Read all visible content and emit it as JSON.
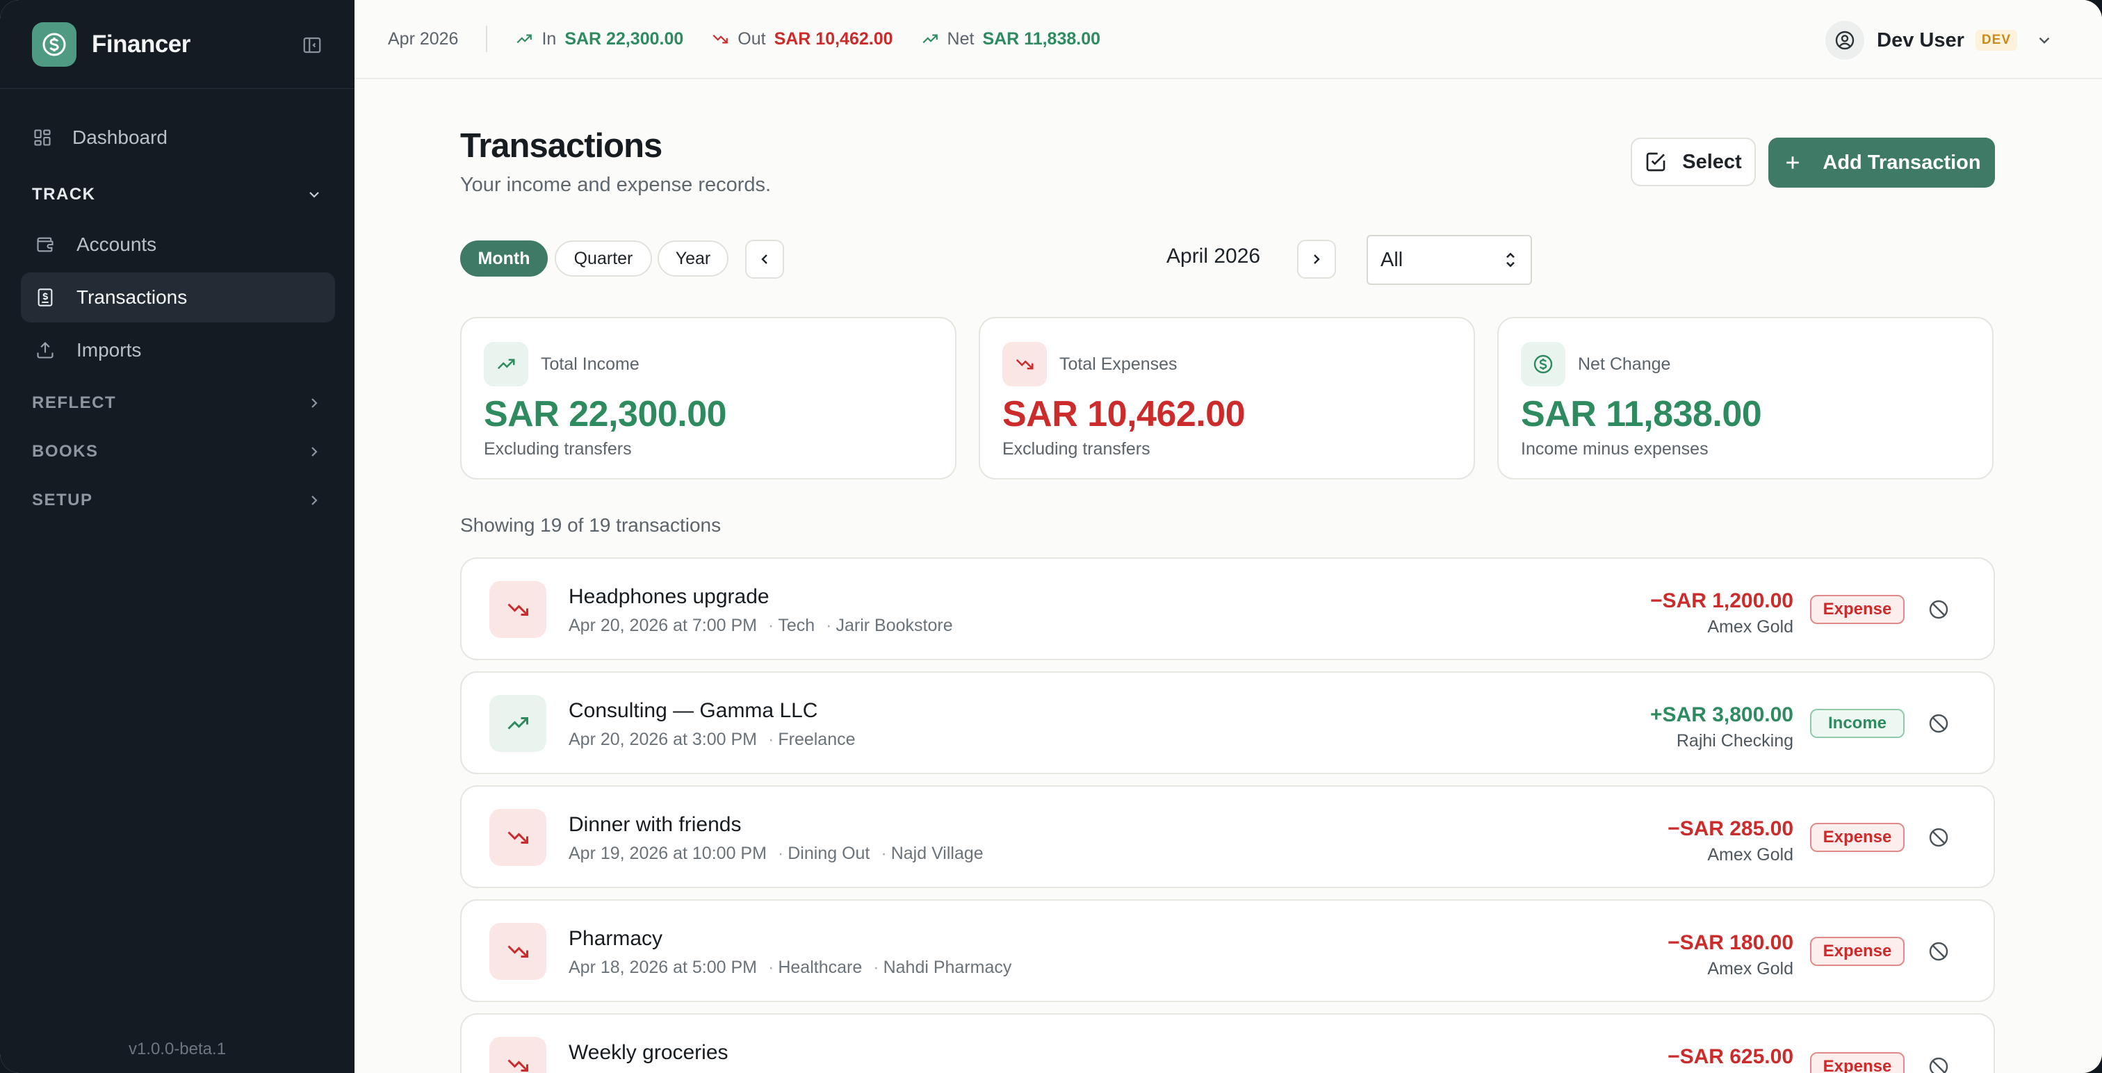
{
  "brand": {
    "name": "Financer"
  },
  "sidebar": {
    "dashboard": "Dashboard",
    "sections": [
      {
        "label": "TRACK"
      },
      {
        "label": "REFLECT"
      },
      {
        "label": "BOOKS"
      },
      {
        "label": "SETUP"
      }
    ],
    "track_items": [
      "Accounts",
      "Transactions",
      "Imports"
    ],
    "version": "v1.0.0-beta.1"
  },
  "topbar": {
    "period": "Apr 2026",
    "in_label": "In",
    "in_value": "SAR 22,300.00",
    "out_label": "Out",
    "out_value": "SAR 10,462.00",
    "net_label": "Net",
    "net_value": "SAR 11,838.00",
    "user_name": "Dev User",
    "env_badge": "DEV"
  },
  "page": {
    "title": "Transactions",
    "subtitle": "Your income and expense records.",
    "select_label": "Select",
    "add_label": "Add Transaction"
  },
  "filters": {
    "ranges": [
      "Month",
      "Quarter",
      "Year"
    ],
    "active_range": "Month",
    "period_label": "April 2026",
    "type_filter": "All"
  },
  "summary": [
    {
      "label": "Total Income",
      "value": "SAR 22,300.00",
      "note": "Excluding transfers"
    },
    {
      "label": "Total Expenses",
      "value": "SAR 10,462.00",
      "note": "Excluding transfers"
    },
    {
      "label": "Net Change",
      "value": "SAR 11,838.00",
      "note": "Income minus expenses"
    }
  ],
  "list": {
    "showing": "Showing 19 of 19 transactions",
    "transactions": [
      {
        "title": "Headphones upgrade",
        "date": "Apr 20, 2026 at 7:00 PM",
        "category": "Tech",
        "merchant": "Jarir Bookstore",
        "amount": "−SAR 1,200.00",
        "account": "Amex Gold",
        "type": "Expense"
      },
      {
        "title": "Consulting — Gamma LLC",
        "date": "Apr 20, 2026 at 3:00 PM",
        "category": "Freelance",
        "merchant": "",
        "amount": "+SAR 3,800.00",
        "account": "Rajhi Checking",
        "type": "Income"
      },
      {
        "title": "Dinner with friends",
        "date": "Apr 19, 2026 at 10:00 PM",
        "category": "Dining Out",
        "merchant": "Najd Village",
        "amount": "−SAR 285.00",
        "account": "Amex Gold",
        "type": "Expense"
      },
      {
        "title": "Pharmacy",
        "date": "Apr 18, 2026 at 5:00 PM",
        "category": "Healthcare",
        "merchant": "Nahdi Pharmacy",
        "amount": "−SAR 180.00",
        "account": "Amex Gold",
        "type": "Expense"
      },
      {
        "title": "Weekly groceries",
        "date": "",
        "category": "",
        "merchant": "",
        "amount": "−SAR 625.00",
        "account": "",
        "type": "Expense"
      }
    ]
  },
  "colors": {
    "accent": "#3f7a66",
    "income": "#2e8b5f",
    "expense": "#cc2b2b",
    "sidebar": "#141b22"
  }
}
